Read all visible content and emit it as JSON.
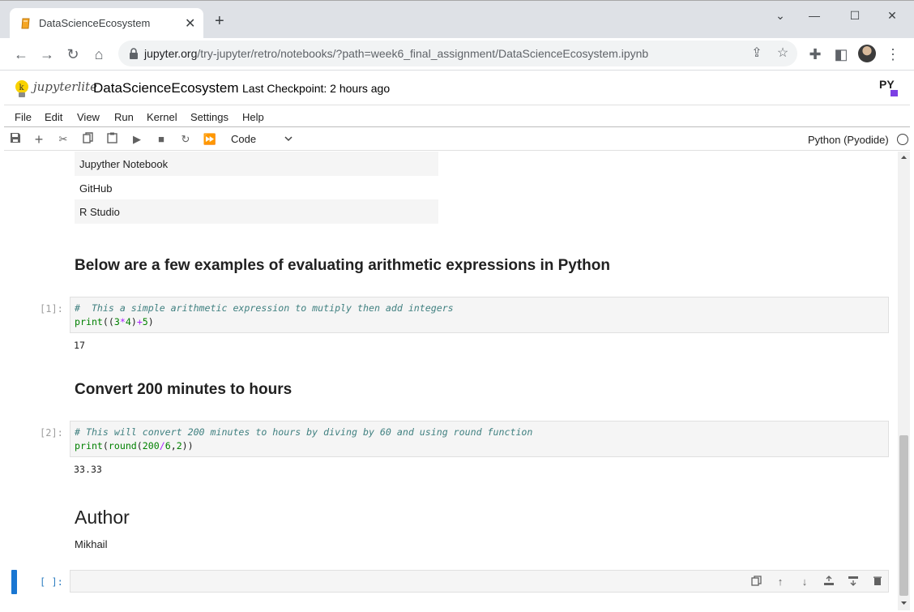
{
  "browser": {
    "tab_title": "DataScienceEcosystem",
    "new_tab_symbol": "+",
    "url_host": "jupyter.org",
    "url_path": "/try-jupyter/retro/notebooks/?path=week6_final_assignment/DataScienceEcosystem.ipynb",
    "window_controls": {
      "minimize": "—",
      "maximize": "☐",
      "close": "✕",
      "tab_list": "⌄"
    }
  },
  "header": {
    "logo_text": "jupyterlite",
    "notebook_title": "DataScienceEcosystem",
    "checkpoint": "Last Checkpoint: 2 hours ago",
    "py_logo_text": "PY"
  },
  "menu": {
    "items": [
      "File",
      "Edit",
      "View",
      "Run",
      "Kernel",
      "Settings",
      "Help"
    ]
  },
  "toolbar": {
    "cell_type": "Code",
    "kernel_name": "Python (Pyodide)"
  },
  "notebook": {
    "tools_list": [
      "Jupyther Notebook",
      "GitHub",
      "R Studio"
    ],
    "heading_examples": "Below are a few examples of evaluating arithmetic expressions in Python",
    "cell1": {
      "prompt": "[1]:",
      "comment": "#  This a simple arithmetic expression to mutiply then add integers",
      "code_print": "print",
      "code_open": "((",
      "code_n1": "3",
      "code_op1": "*",
      "code_n2": "4",
      "code_close1": ")",
      "code_op2": "+",
      "code_n3": "5",
      "code_close2": ")",
      "output": "17"
    },
    "heading_convert": "Convert 200 minutes to hours",
    "cell2": {
      "prompt": "[2]:",
      "comment": "# This will convert 200 minutes to hours by diving by 60 and using round function",
      "code_print": "print",
      "code_open": "(",
      "code_round": "round",
      "code_open2": "(",
      "code_n1": "200",
      "code_op": "/",
      "code_n2": "6",
      "code_comma": ",",
      "code_n3": "2",
      "code_close": "))",
      "output": "33.33"
    },
    "heading_author": "Author",
    "author_name": "Mikhail",
    "empty_prompt": "[ ]:"
  },
  "colors": {
    "accent": "#1976d2",
    "tab_strip": "#dee1e6",
    "cell_bg": "#f5f5f5"
  }
}
